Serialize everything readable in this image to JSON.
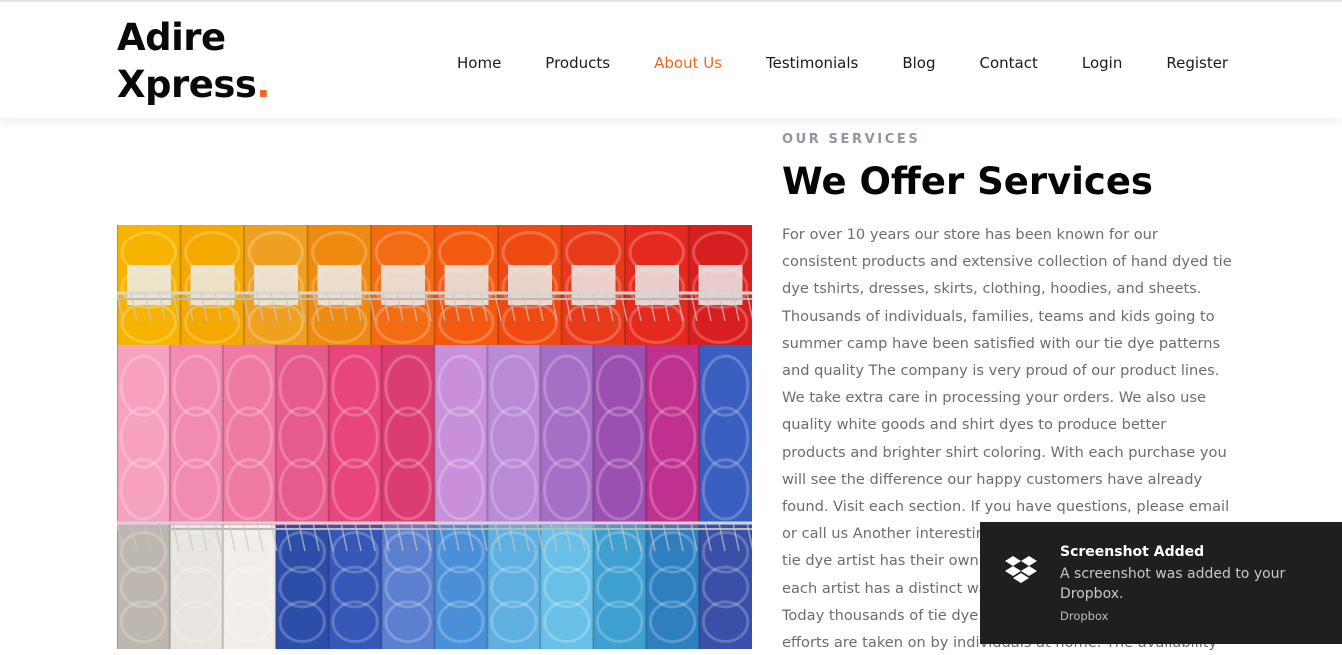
{
  "brand": {
    "line1": "Adire",
    "line2": "Xpress",
    "dot": ".",
    "accent_color": "#f26522"
  },
  "nav": {
    "items": [
      {
        "label": "Home",
        "active": false
      },
      {
        "label": "Products",
        "active": false
      },
      {
        "label": "About Us",
        "active": true
      },
      {
        "label": "Testimonials",
        "active": false
      },
      {
        "label": "Blog",
        "active": false
      },
      {
        "label": "Contact",
        "active": false
      },
      {
        "label": "Login",
        "active": false
      },
      {
        "label": "Register",
        "active": false
      }
    ]
  },
  "services": {
    "eyebrow": "OUR SERVICES",
    "title": "We Offer Services",
    "body": "For over 10 years our store has been known for our consistent products and extensive collection of hand dyed tie dye tshirts, dresses, skirts, clothing, hoodies, and sheets. Thousands of individuals, families, teams and kids going to summer camp have been satisfied with our tie dye patterns and quality The company is very proud of our product lines. We take extra care in processing your orders. We also use quality white goods and shirt dyes to produce better products and brighter shirt coloring. With each purchase you will see the difference our happy customers have already found. Visit each section. If you have questions, please email or call us Another interesting note is how each professional tie dye artist has their own style and every design. It appears each artist has a distinct way to create their niche of work. Today thousands of tie dye enthusiasts and their project efforts are taken on by individuals at home. The availability of a diy kit in craft stores has certainly aided the",
    "image_alt": "Shelves of colorful yarn skeins"
  },
  "toast": {
    "title": "Screenshot Added",
    "message": "A screenshot was added to your Dropbox.",
    "source": "Dropbox",
    "icon": "dropbox-icon"
  }
}
